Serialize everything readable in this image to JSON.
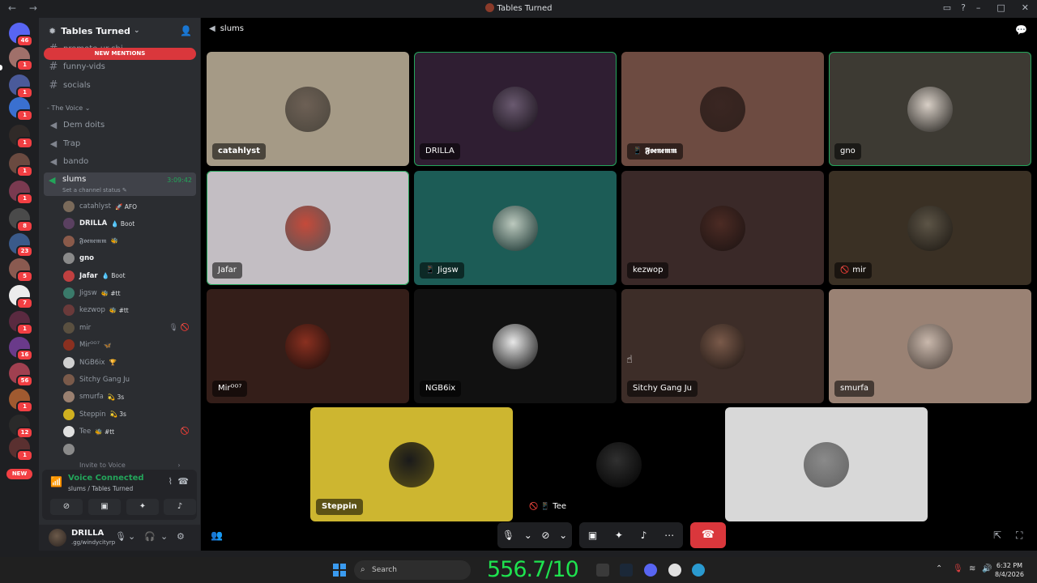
{
  "window": {
    "title": "Tables Turned",
    "nav": "← →"
  },
  "server": {
    "name": "Tables Turned",
    "new_mentions": "NEW MENTIONS"
  },
  "channels": {
    "text": [
      {
        "name": "promote-ur-shi"
      },
      {
        "name": "funny-vids"
      },
      {
        "name": "socials"
      }
    ],
    "category": "- The Voice",
    "voice": [
      {
        "name": "Dem doits"
      },
      {
        "name": "Trap"
      },
      {
        "name": "bando"
      }
    ],
    "active": {
      "name": "slums",
      "time": "3:09:42",
      "status": "Set a channel status"
    }
  },
  "members": [
    {
      "name": "catahlyst",
      "tag": "🚀 AFO",
      "bold": false,
      "color": "#7a6a5a"
    },
    {
      "name": "DRILLA",
      "tag": "💧 Boot",
      "bold": true,
      "color": "#5a4060"
    },
    {
      "name": "𝕱𝖔𝖊𝖓𝖊𝖒𝖒",
      "tag": "🐝",
      "bold": false,
      "color": "#8a5a4a"
    },
    {
      "name": "gno",
      "tag": "",
      "bold": true,
      "color": "#8a8a8a"
    },
    {
      "name": "Jafar",
      "tag": "💧 Boot",
      "bold": true,
      "color": "#c04040"
    },
    {
      "name": "Jigsw",
      "tag": "🐝 #tt",
      "bold": false,
      "color": "#3a7a6a"
    },
    {
      "name": "kezwop",
      "tag": "🐝 #tt",
      "bold": false,
      "color": "#6a3a3a"
    },
    {
      "name": "mir",
      "tag": "",
      "bold": false,
      "color": "#5a5040",
      "right": "🎙 🚫"
    },
    {
      "name": "Mirᴼᴼ⁷",
      "tag": "🦋",
      "bold": false,
      "color": "#8a3020"
    },
    {
      "name": "NGB6ix",
      "tag": "🏆",
      "bold": false,
      "color": "#d0d0d0"
    },
    {
      "name": "Sitchy Gang Ju",
      "tag": "",
      "bold": false,
      "color": "#7a5a4a"
    },
    {
      "name": "smurfa",
      "tag": "💫 3s",
      "bold": false,
      "color": "#9a8070"
    },
    {
      "name": "Steppin",
      "tag": "💫 3s",
      "bold": false,
      "color": "#d0b020"
    },
    {
      "name": "Tee",
      "tag": "🐝 #tt",
      "bold": false,
      "color": "#e0e0e0",
      "right": "🚫"
    },
    {
      "name": "",
      "tag": "",
      "bold": false,
      "color": "#8a8a8a"
    }
  ],
  "invite_voice": "Invite to Voice",
  "voice_panel": {
    "status": "Voice Connected",
    "sub": "slums / Tables Turned"
  },
  "user": {
    "name": "DRILLA",
    "status": ".gg/windycityrp"
  },
  "main": {
    "channel": "slums"
  },
  "tiles": [
    {
      "name": "catahlyst",
      "bold": true,
      "icon": "",
      "bg": "#a59a86",
      "avatar": "#6d6055",
      "speaking": false
    },
    {
      "name": "DRILLA",
      "bold": false,
      "icon": "",
      "bg": "#2f1e32",
      "avatar": "#6a5a70",
      "speaking": true
    },
    {
      "name": "𝕱𝖔𝖊𝖓𝖊𝖒𝖒",
      "bold": true,
      "icon": "📱",
      "bg": "#6d4b41",
      "avatar": "#3a2622",
      "speaking": false
    },
    {
      "name": "gno",
      "bold": false,
      "icon": "",
      "bg": "#3d3a33",
      "avatar": "#d8cfc6",
      "speaking": true
    },
    {
      "name": "Jafar",
      "bold": false,
      "icon": "",
      "bg": "#c3bec3",
      "avatar": "#c54a3a",
      "speaking": true
    },
    {
      "name": "Jigsw",
      "bold": false,
      "icon": "📱",
      "bg": "#1c5c56",
      "avatar": "#bcc9be",
      "speaking": false
    },
    {
      "name": "kezwop",
      "bold": false,
      "icon": "",
      "bg": "#3a2928",
      "avatar": "#4c2b24",
      "speaking": false
    },
    {
      "name": "mir",
      "bold": false,
      "icon": "🚫",
      "bg": "#3a3024",
      "avatar": "#5d5547",
      "speaking": false
    },
    {
      "name": "Mirᴼᴼ⁷",
      "bold": false,
      "icon": "",
      "bg": "#341e19",
      "avatar": "#8a3020",
      "speaking": false
    },
    {
      "name": "NGB6ix",
      "bold": false,
      "icon": "",
      "bg": "#111111",
      "avatar": "#e8e8e8",
      "speaking": false
    },
    {
      "name": "Sitchy Gang Ju",
      "bold": false,
      "icon": "",
      "bg": "#3d2d28",
      "avatar": "#7a5a4a",
      "speaking": false
    },
    {
      "name": "smurfa",
      "bold": false,
      "icon": "",
      "bg": "#9a8274",
      "avatar": "#c9b8ac",
      "speaking": false
    },
    {
      "name": "Steppin",
      "bold": true,
      "icon": "",
      "bg": "#cdb630",
      "avatar": "#1a1a1a",
      "speaking": false
    },
    {
      "name": "Tee",
      "bold": false,
      "icon": "🚫 📱",
      "bg": "#000000",
      "avatar": "#303030",
      "speaking": false
    },
    {
      "name": "",
      "bold": false,
      "icon": "",
      "bg": "#d8d8d8",
      "avatar": "#8a8a8a",
      "speaking": false
    }
  ],
  "taskbar": {
    "search": "Search",
    "counter": "556.7/10",
    "time": "6:32 PM",
    "date": "8/4/2026"
  },
  "colors": {
    "online": "#23a55a",
    "danger": "#da373c",
    "background": "#1e1f22",
    "sidebar": "#2b2d31"
  }
}
